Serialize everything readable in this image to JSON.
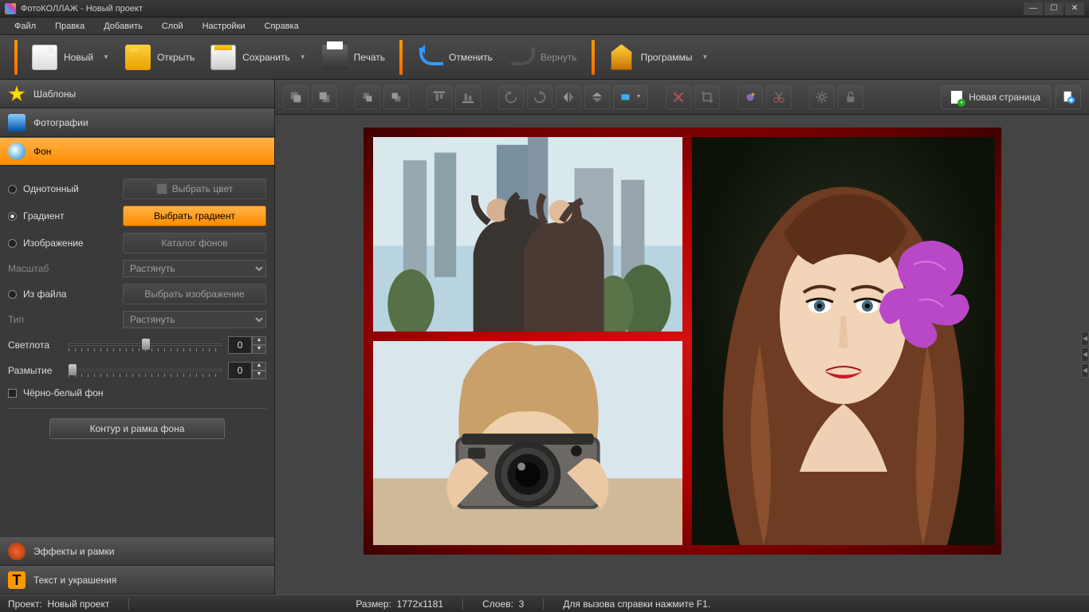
{
  "window": {
    "title": "ФотоКОЛЛАЖ - Новый проект"
  },
  "menubar": [
    "Файл",
    "Правка",
    "Добавить",
    "Слой",
    "Настройки",
    "Справка"
  ],
  "toolbar": {
    "new": "Новый",
    "open": "Открыть",
    "save": "Сохранить",
    "print": "Печать",
    "undo": "Отменить",
    "redo": "Вернуть",
    "programs": "Программы"
  },
  "accordion": {
    "templates": "Шаблоны",
    "photos": "Фотографии",
    "background": "Фон",
    "effects": "Эффекты и рамки",
    "text": "Текст и украшения"
  },
  "bg_panel": {
    "solid": "Однотонный",
    "solid_btn": "Выбрать цвет",
    "gradient": "Градиент",
    "gradient_btn": "Выбрать градиент",
    "image": "Изображение",
    "image_btn": "Каталог фонов",
    "scale": "Масштаб",
    "scale_val": "Растянуть",
    "file": "Из файла",
    "file_btn": "Выбрать изображение",
    "type": "Тип",
    "type_val": "Растянуть",
    "brightness": "Светлота",
    "brightness_val": "0",
    "blur": "Размытие",
    "blur_val": "0",
    "bw": "Чёрно-белый фон",
    "frame_btn": "Контур и рамка фона"
  },
  "canvas_toolbar": {
    "new_page": "Новая страница"
  },
  "statusbar": {
    "project_lbl": "Проект:",
    "project_name": "Новый проект",
    "size_lbl": "Размер:",
    "size_val": "1772x1181",
    "layers_lbl": "Слоев:",
    "layers_val": "3",
    "help": "Для вызова справки нажмите F1."
  }
}
